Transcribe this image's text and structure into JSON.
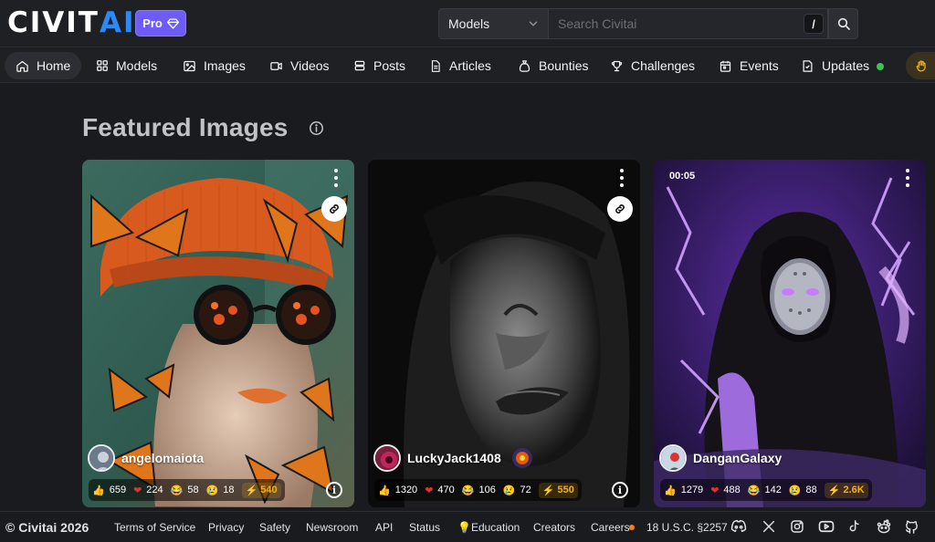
{
  "header": {
    "logo_part1": "CIVIT",
    "logo_part2": "AI",
    "pro_label": "Pro",
    "search_type": "Models",
    "search_placeholder": "Search Civitai",
    "slash_key": "/"
  },
  "nav": {
    "items": [
      {
        "label": "Home",
        "icon": "home-icon"
      },
      {
        "label": "Models",
        "icon": "grid-icon"
      },
      {
        "label": "Images",
        "icon": "image-icon"
      },
      {
        "label": "Videos",
        "icon": "video-icon"
      },
      {
        "label": "Posts",
        "icon": "posts-icon"
      },
      {
        "label": "Articles",
        "icon": "article-icon"
      },
      {
        "label": "Bounties",
        "icon": "moneybag-icon"
      },
      {
        "label": "Challenges",
        "icon": "trophy-icon"
      },
      {
        "label": "Events",
        "icon": "calendar-icon"
      },
      {
        "label": "Updates",
        "icon": "updates-icon"
      }
    ],
    "active": "Home"
  },
  "main": {
    "title": "Featured Images"
  },
  "cards": [
    {
      "username": "angelomaiota",
      "duration": "",
      "likes": "659",
      "hearts": "224",
      "laughs": "58",
      "cries": "18",
      "buzz": "540"
    },
    {
      "username": "LuckyJack1408",
      "duration": "",
      "likes": "1320",
      "hearts": "470",
      "laughs": "106",
      "cries": "72",
      "buzz": "550"
    },
    {
      "username": "DanganGalaxy",
      "duration": "00:05",
      "likes": "1279",
      "hearts": "488",
      "laughs": "142",
      "cries": "88",
      "buzz": "2.6K"
    }
  ],
  "footer": {
    "copyright": "© Civitai 2026",
    "links": [
      "Terms of Service",
      "Privacy",
      "Safety",
      "Newsroom",
      "API",
      "Status",
      "Education",
      "Creators",
      "Careers",
      "18 U.S.C. §2257"
    ]
  },
  "colors": {
    "accent": "#2b8af7",
    "pro": "#6d5cf7",
    "buzz": "#fab005",
    "online": "#40c057"
  }
}
